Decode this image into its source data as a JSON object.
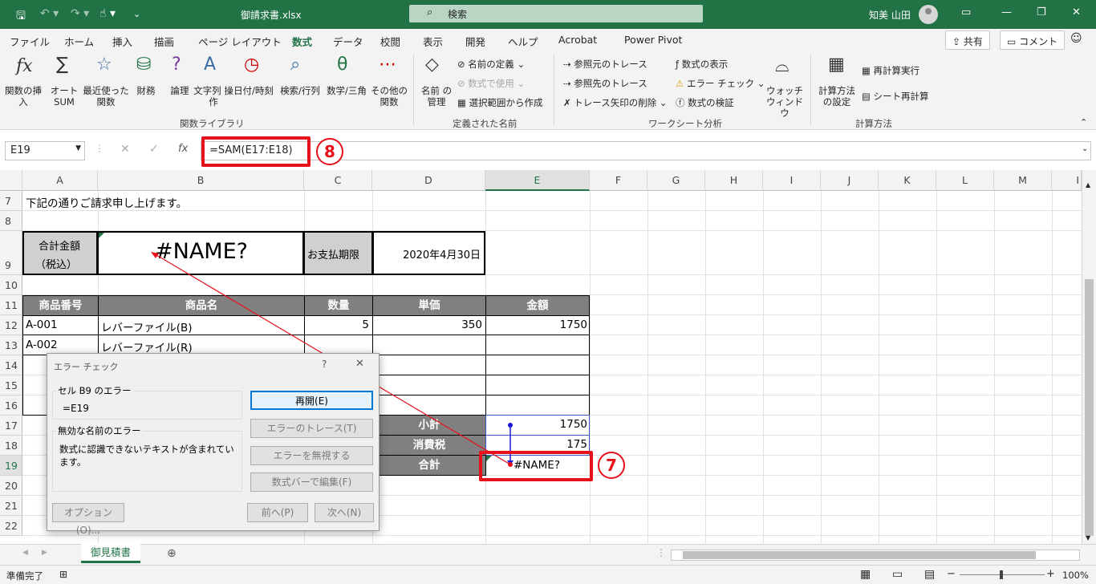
{
  "titlebar": {
    "filename": "御請求書.xlsx",
    "search": "検索",
    "user": "知美 山田"
  },
  "tabs": [
    "ファイル",
    "ホーム",
    "挿入",
    "描画",
    "ページ レイアウト",
    "数式",
    "データ",
    "校閲",
    "表示",
    "開発",
    "ヘルプ",
    "Acrobat",
    "Power Pivot"
  ],
  "top_buttons": {
    "share": "共有",
    "comment": "コメント"
  },
  "ribbon": {
    "functions": [
      "関数の挿入",
      "オート SUM",
      "最近使った 関数",
      "財務",
      "論理",
      "文字列 操作",
      "日付/時刻",
      "検索/行列",
      "数学/三角",
      "その他の 関数"
    ],
    "group_function_library": "関数ライブラリ",
    "define_name": "名前の定義",
    "use_in_formula": "数式で使用",
    "name_manager": "名前 の管理",
    "create_from_selection": "選択範囲から作成",
    "group_defined_names": "定義された名前",
    "trace_precedents": "参照元のトレース",
    "trace_dependents": "参照先のトレース",
    "remove_arrows": "トレース矢印の削除",
    "show_formulas": "数式の表示",
    "error_checking": "エラー チェック",
    "evaluate_formula": "数式の検証",
    "watch_window": "ウォッチ ウィンドウ",
    "group_formula_auditing": "ワークシート分析",
    "calc_options": "計算方法 の設定",
    "calc_now": "再計算実行",
    "calc_sheet": "シート再計算",
    "group_calculation": "計算方法"
  },
  "formula_bar": {
    "name_box": "E19",
    "formula": "=SAM(E17:E18)"
  },
  "columns": [
    "A",
    "B",
    "C",
    "D",
    "E",
    "F",
    "G",
    "H",
    "I",
    "J",
    "K",
    "L",
    "M",
    "I"
  ],
  "rows": [
    "7",
    "8",
    "9",
    "10",
    "11",
    "12",
    "13",
    "14",
    "15",
    "16",
    "17",
    "18",
    "19",
    "20",
    "21",
    "22"
  ],
  "sheet": {
    "intro": "下記の通りご請求申し上げます。",
    "total_label_1": "合計金額",
    "total_label_2": "（税込）",
    "total_value": "#NAME?",
    "due_label": "お支払期限",
    "due_value": "2020年4月30日",
    "headers": [
      "商品番号",
      "商品名",
      "数量",
      "単価",
      "金額"
    ],
    "items": [
      {
        "code": "A-001",
        "name": "レバーファイル(B)",
        "qty": "5",
        "price": "350",
        "amount": "1750"
      },
      {
        "code": "A-002",
        "name": "レバーファイル(R)",
        "qty": "",
        "price": "",
        "amount": ""
      }
    ],
    "subtotal_label": "小計",
    "subtotal_value": "1750",
    "tax_label": "消費税",
    "tax_value": "175",
    "grand_label": "合計",
    "grand_value": "#NAME?"
  },
  "dialog": {
    "title": "エラー チェック",
    "help": "?",
    "close": "✕",
    "cell_label": "セル B9 のエラー",
    "cell_formula": "=E19",
    "error_title": "無効な名前のエラー",
    "error_desc": "数式に認識できないテキストが含まれています。",
    "btn_resume": "再開(E)",
    "btn_trace": "エラーのトレース(T)",
    "btn_ignore": "エラーを無視する",
    "btn_edit": "数式バーで編集(F)",
    "btn_options": "オプション(O)...",
    "btn_prev": "前へ(P)",
    "btn_next": "次へ(N)"
  },
  "sheet_tab": "御見積書",
  "status": {
    "ready": "準備完了",
    "zoom": "100%"
  },
  "annotations": {
    "badge7": "7",
    "badge8": "8"
  },
  "colors": {
    "accent": "#217346",
    "callout": "#e8101a",
    "header_fill": "#808080"
  }
}
